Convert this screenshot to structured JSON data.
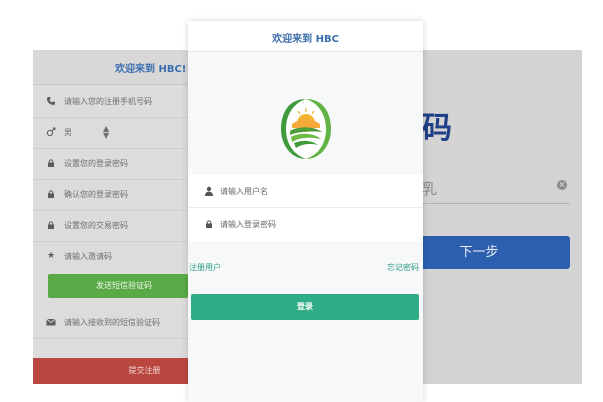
{
  "colors": {
    "brand_blue": "#2c5fae",
    "login_green": "#30ad86",
    "sms_green": "#5aaa48",
    "submit_red": "#b9473f"
  },
  "right_screen": {
    "big_char": "码",
    "field_text": "乳",
    "next_button": "下一步"
  },
  "register_screen": {
    "title": "欢迎来到 HBC!",
    "fields": [
      {
        "icon": "phone-icon",
        "text": "请输入您的注册手机号码"
      },
      {
        "icon": "gender-icon",
        "text": "男"
      },
      {
        "icon": "lock-icon",
        "text": "设置您的登录密码"
      },
      {
        "icon": "lock-icon",
        "text": "确认您的登录密码"
      },
      {
        "icon": "lock-icon",
        "text": "设置您的交易密码"
      },
      {
        "icon": "star-icon",
        "text": "请输入邀请码"
      }
    ],
    "sms_button": "发送短信验证码",
    "sms_code_placeholder": "请输入接收到的短信验证码",
    "submit_button": "提交注册"
  },
  "login_screen": {
    "title": "欢迎来到 HBC",
    "username_placeholder": "请输入用户名",
    "password_placeholder": "请输入登录密码",
    "register_link": "注册用户",
    "forgot_link": "忘记密码",
    "login_button": "登录"
  }
}
